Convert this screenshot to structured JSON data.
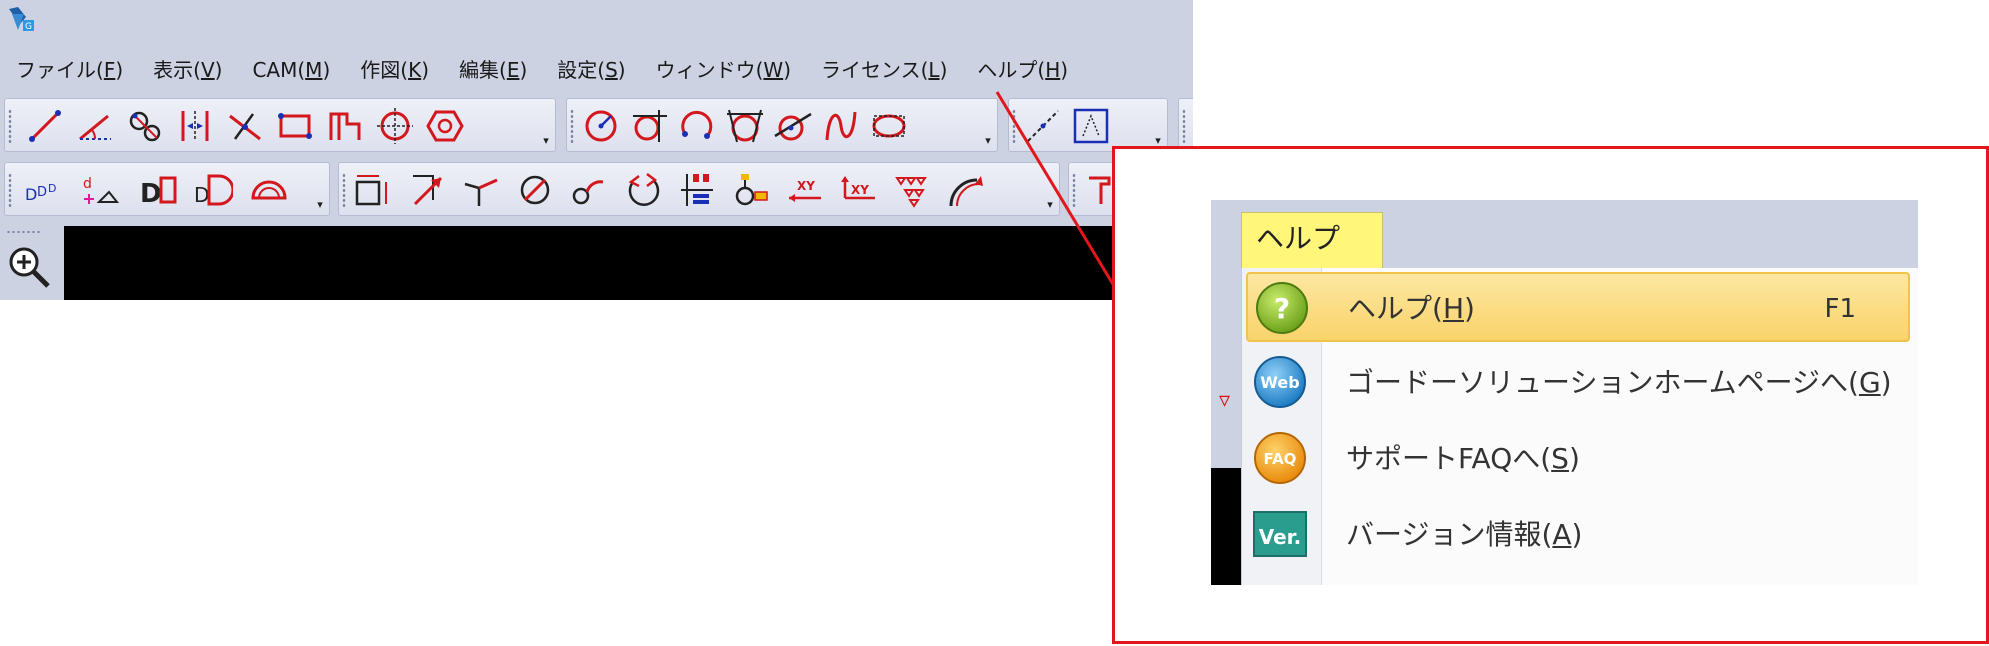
{
  "menu": [
    {
      "name": "file",
      "pre": "ファイル(",
      "key": "F",
      "post": ")"
    },
    {
      "name": "view",
      "pre": "表示(",
      "key": "V",
      "post": ")"
    },
    {
      "name": "cam",
      "pre": "CAM(",
      "key": "M",
      "post": ")"
    },
    {
      "name": "draw",
      "pre": "作図(",
      "key": "K",
      "post": ")"
    },
    {
      "name": "edit",
      "pre": "編集(",
      "key": "E",
      "post": ")"
    },
    {
      "name": "settings",
      "pre": "設定(",
      "key": "S",
      "post": ")"
    },
    {
      "name": "window",
      "pre": "ウィンドウ(",
      "key": "W",
      "post": ")"
    },
    {
      "name": "license",
      "pre": "ライセンス(",
      "key": "L",
      "post": ")"
    },
    {
      "name": "help",
      "pre": "ヘルプ(",
      "key": "H",
      "post": ")"
    }
  ],
  "toolbar_icons": {
    "row1": [
      "line-tool-icon",
      "angle-line-tool-icon",
      "circle-link-tool-icon",
      "parallel-line-tool-icon",
      "intersect-line-tool-icon",
      "rectangle-tool-icon",
      "step-shape-tool-icon",
      "crosshair-circle-tool-icon",
      "hexagon-tool-icon",
      "circle-radius-tool-icon",
      "circle-tangent-tool-icon",
      "arc-tool-icon",
      "circle-three-point-tool-icon",
      "circle-tangent-line-tool-icon",
      "spline-tool-icon",
      "ellipse-tool-icon",
      "dashed-line-tool-icon",
      "text-frame-tool-icon"
    ],
    "row2": [
      "dimension-text-tool-icon",
      "angle-dimension-tool-icon",
      "dimension-d-tool-icon",
      "dimension-dd-tool-icon",
      "protractor-tool-icon",
      "box-dimension-tool-icon",
      "arrow-tool-icon",
      "branch-tool-icon",
      "circle-slash-tool-icon",
      "circle-arc-tool-icon",
      "rotate-tool-icon",
      "grid-block-tool-icon",
      "point-marker-tool-icon",
      "move-xy-tool-icon",
      "copy-xy-tool-icon",
      "triangle-mark-tool-icon",
      "curve-arrow-tool-icon",
      "edge-tool-icon"
    ]
  },
  "zoom_icon": "zoom-in-icon",
  "callout": {
    "active_menu": {
      "pre": "ヘルプ(",
      "key": "H",
      "post": ")"
    },
    "items": [
      {
        "icon": "help-question-icon",
        "pre": "ヘルプ(",
        "key": "H",
        "post": ")",
        "shortcut": "F1",
        "highlighted": true
      },
      {
        "icon": "web-globe-icon",
        "icon_text": "Web",
        "pre": "ゴードーソリューションホームページへ(",
        "key": "G",
        "post": ")",
        "shortcut": "",
        "highlighted": false
      },
      {
        "icon": "faq-icon",
        "icon_text": "FAQ",
        "pre": "サポートFAQへ(",
        "key": "S",
        "post": ")",
        "shortcut": "",
        "highlighted": false
      },
      {
        "icon": "version-info-icon",
        "icon_text": "Ver.",
        "pre": "バージョン情報(",
        "key": "A",
        "post": ")",
        "shortcut": "",
        "highlighted": false
      }
    ]
  },
  "colors": {
    "chrome": "#cdd2e3",
    "highlight_callout": "#e3161b",
    "menu_active": "#fff67a",
    "item_hover": "#f9d36a"
  }
}
